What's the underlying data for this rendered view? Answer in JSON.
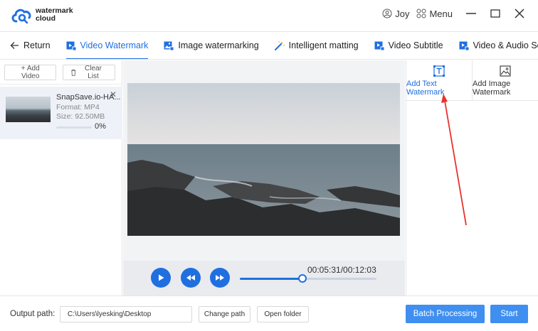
{
  "app": {
    "logo_text_line1": "watermark",
    "logo_text_line2": "cloud",
    "user": "Joy",
    "menu_label": "Menu"
  },
  "nav": {
    "return_label": "Return",
    "tabs": [
      {
        "label": "Video Watermark",
        "active": true
      },
      {
        "label": "Image watermarking",
        "active": false
      },
      {
        "label": "Intelligent matting",
        "active": false
      },
      {
        "label": "Video Subtitle",
        "active": false
      },
      {
        "label": "Video & Audio Sepa",
        "active": false
      }
    ]
  },
  "left": {
    "add_video": "+ Add Video",
    "clear_list": "Clear List",
    "file": {
      "name": "SnapSave.io-HA...",
      "format": "Format:  MP4",
      "size": "Size:  92.50MB",
      "progress_percent": 0,
      "progress_text": "0%"
    }
  },
  "player": {
    "time": "00:05:31/00:12:03",
    "position_fraction": 0.458
  },
  "right": {
    "add_text_line1": "Add Text",
    "add_text_line2": "Watermark",
    "add_image_line1": "Add Image",
    "add_image_line2": "Watermark"
  },
  "footer": {
    "output_label": "Output path:",
    "output_path": "C:\\Users\\lyesking\\Desktop",
    "change_path": "Change path",
    "open_folder": "Open folder",
    "batch": "Batch Processing",
    "start": "Start"
  },
  "colors": {
    "accent": "#1f6fe0",
    "primary_button": "#3f8ff0",
    "annotation_arrow": "#e8322e"
  }
}
